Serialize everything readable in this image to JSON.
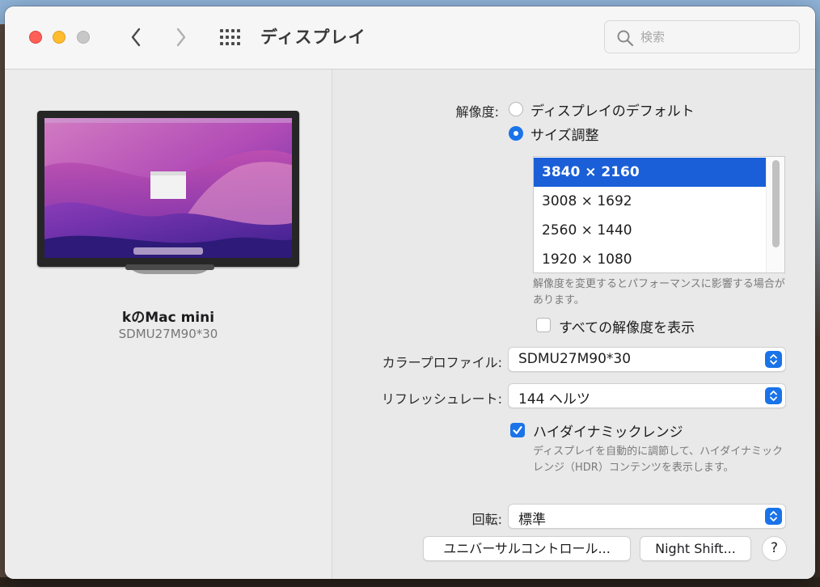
{
  "window": {
    "title": "ディスプレイ",
    "search_placeholder": "検索"
  },
  "device": {
    "name": "kのMac mini",
    "model": "SDMU27M90*30"
  },
  "resolution": {
    "label": "解像度:",
    "options": [
      {
        "label": "ディスプレイのデフォルト",
        "selected": false
      },
      {
        "label": "サイズ調整",
        "selected": true
      }
    ],
    "list": [
      "3840 × 2160",
      "3008 × 1692",
      "2560 × 1440",
      "1920 × 1080"
    ],
    "selected_index": 0,
    "note": "解像度を変更するとパフォーマンスに影響する場合があります。",
    "show_all_label": "すべての解像度を表示",
    "show_all_checked": false
  },
  "color_profile": {
    "label": "カラープロファイル:",
    "value": "SDMU27M90*30"
  },
  "refresh_rate": {
    "label": "リフレッシュレート:",
    "value": "144 ヘルツ"
  },
  "hdr": {
    "label": "ハイダイナミックレンジ",
    "checked": true,
    "description": "ディスプレイを自動的に調節して、ハイダイナミックレンジ（HDR）コンテンツを表示します。"
  },
  "rotation": {
    "label": "回転:",
    "value": "標準"
  },
  "buttons": {
    "universal_control": "ユニバーサルコントロール...",
    "night_shift": "Night Shift...",
    "help": "?"
  },
  "colors": {
    "accent": "#1a73e8",
    "list_selection": "#1a5fd7",
    "close": "#fe5f57",
    "minimize": "#febc2e",
    "zoom_inactive": "#c7c7c7"
  }
}
